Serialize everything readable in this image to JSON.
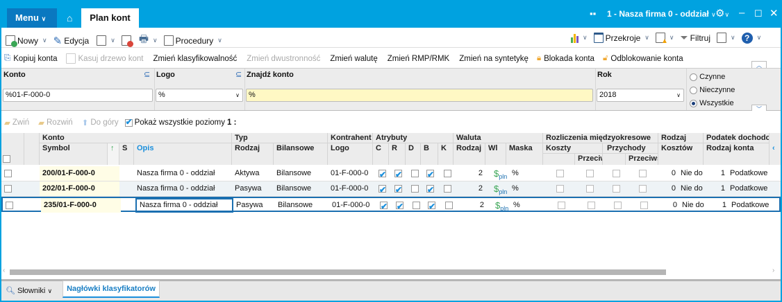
{
  "titlebar": {
    "menu": "Menu",
    "tab": "Plan kont",
    "company": "1 - Nasza firma 0 - oddział"
  },
  "toolbar": {
    "new": "Nowy",
    "edit": "Edycja",
    "procedures": "Procedury",
    "sections": "Przekroje",
    "filter": "Filtruj"
  },
  "toolbar2": {
    "copy": "Kopiuj konta",
    "delete_tree": "Kasuj drzewo kont",
    "change_class": "Zmień klasyfikowalność",
    "change_two_sided": "Zmień dwustronność",
    "change_currency": "Zmień walutę",
    "change_rmp": "Zmień RMP/RMK",
    "change_synth": "Zmień na syntetykę",
    "lock": "Blokada konta",
    "unlock": "Odblokowanie konta"
  },
  "filters": {
    "konto_label": "Konto",
    "konto_value": "%01-F-000-0",
    "logo_label": "Logo",
    "logo_value": "%",
    "find_label": "Znajdź konto",
    "find_value": "%",
    "year_label": "Rok",
    "year_value": "2018",
    "radio": [
      "Czynne",
      "Nieczynne",
      "Wszystkie"
    ],
    "radio_selected": 2
  },
  "treebar": {
    "collapse": "Zwiń",
    "expand": "Rozwiń",
    "up": "Do góry",
    "show_all": "Pokaż wszystkie poziomy",
    "level": "1 :"
  },
  "headers": {
    "konto": "Konto",
    "symbol": "Symbol",
    "s": "S",
    "opis": "Opis",
    "typ": "Typ",
    "rodzaj": "Rodzaj",
    "bilansowe": "Bilansowe",
    "kontrahent": "Kontrahent",
    "logo": "Logo",
    "atrybuty": "Atrybuty",
    "c": "C",
    "r": "R",
    "d": "D",
    "b": "B",
    "k": "K",
    "waluta": "Waluta",
    "w_rodzaj": "Rodzaj",
    "wl": "Wl",
    "maska": "Maska",
    "rozliczenia": "Rozliczenia międzyokresowe",
    "koszty": "Koszty",
    "przychody": "Przychody",
    "przeciw1": "Przeciw",
    "przeciw2": "Przeciws",
    "rodzaj2": "Rodzaj",
    "kosztow": "Kosztów",
    "podatek": "Podatek dochodowy",
    "rodzaj_konta": "Rodzaj konta"
  },
  "rows": [
    {
      "symbol": "200/01-F-000-0",
      "opis": "Nasza firma 0 - oddział",
      "rodzaj": "Aktywa",
      "bilansowe": "Bilansowe",
      "logo": "01-F-000-0",
      "c": true,
      "r": true,
      "d": false,
      "b": true,
      "k": false,
      "w_rodzaj": "2",
      "wl": "pln",
      "maska": "%",
      "kosztow_n": "0",
      "kosztow": "Nie do",
      "pod_n": "1",
      "pod": "Podatkowe"
    },
    {
      "symbol": "202/01-F-000-0",
      "opis": "Nasza firma 0 - oddział",
      "rodzaj": "Pasywa",
      "bilansowe": "Bilansowe",
      "logo": "01-F-000-0",
      "c": true,
      "r": true,
      "d": false,
      "b": true,
      "k": false,
      "w_rodzaj": "2",
      "wl": "pln",
      "maska": "%",
      "kosztow_n": "0",
      "kosztow": "Nie do",
      "pod_n": "1",
      "pod": "Podatkowe"
    },
    {
      "symbol": "235/01-F-000-0",
      "opis": "Nasza firma 0 - oddział",
      "rodzaj": "Pasywa",
      "bilansowe": "Bilansowe",
      "logo": "01-F-000-0",
      "c": true,
      "r": true,
      "d": false,
      "b": true,
      "k": false,
      "w_rodzaj": "2",
      "wl": "pln",
      "maska": "%",
      "kosztow_n": "0",
      "kosztow": "Nie do",
      "pod_n": "1",
      "pod": "Podatkowe"
    }
  ],
  "bottom": {
    "dictionaries": "Słowniki",
    "headers_tab": "Nagłówki klasyfikatorów"
  }
}
